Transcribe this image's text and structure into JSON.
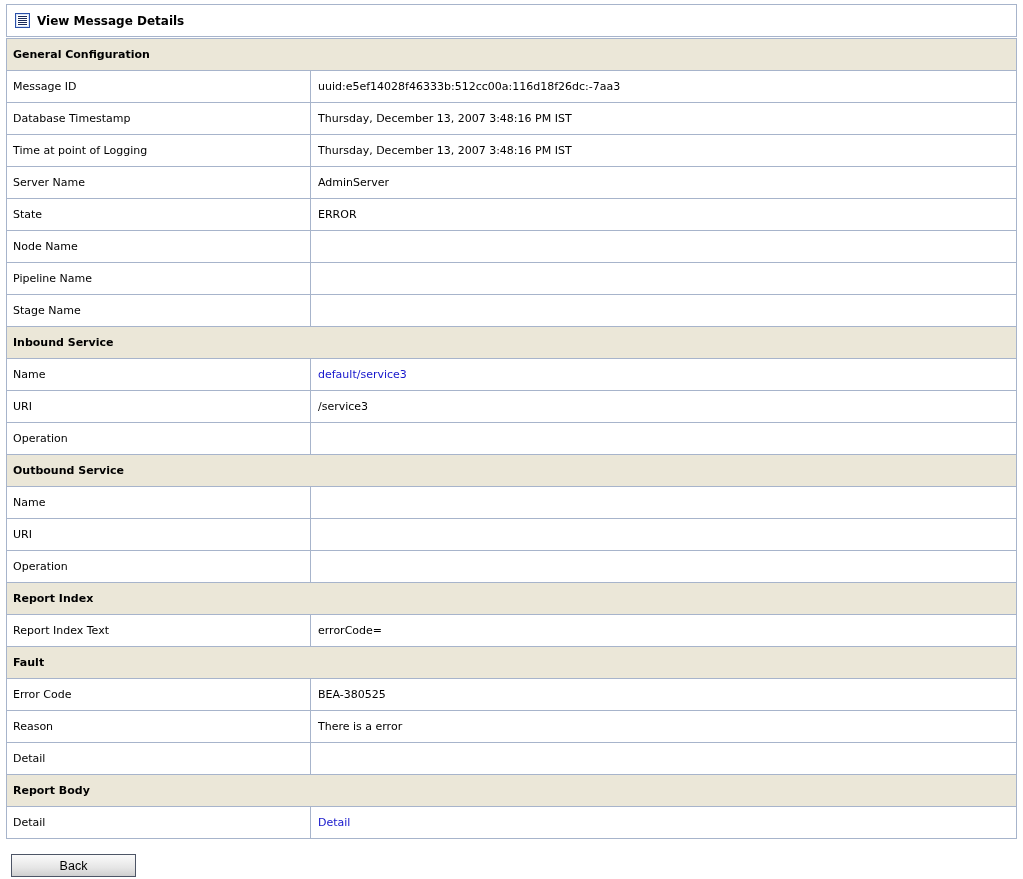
{
  "header": {
    "title": "View Message Details"
  },
  "sections": [
    {
      "title": "General Configuration",
      "rows": [
        {
          "label": "Message ID",
          "value": "uuid:e5ef14028f46333b:512cc00a:116d18f26dc:-7aa3",
          "kind": "text"
        },
        {
          "label": "Database Timestamp",
          "value": "Thursday, December 13, 2007 3:48:16 PM IST",
          "kind": "text"
        },
        {
          "label": "Time at point of Logging",
          "value": "Thursday, December 13, 2007 3:48:16 PM IST",
          "kind": "text"
        },
        {
          "label": "Server Name",
          "value": "AdminServer",
          "kind": "text"
        },
        {
          "label": "State",
          "value": "ERROR",
          "kind": "text"
        },
        {
          "label": "Node Name"
        },
        {
          "label": "Pipeline Name"
        },
        {
          "label": "Stage Name"
        }
      ]
    },
    {
      "title": "Inbound Service",
      "rows": [
        {
          "label": "Name",
          "value": "default/service3",
          "kind": "link"
        },
        {
          "label": "URI",
          "value": "/service3",
          "kind": "text"
        },
        {
          "label": "Operation"
        }
      ]
    },
    {
      "title": "Outbound Service",
      "rows": [
        {
          "label": "Name"
        },
        {
          "label": "URI"
        },
        {
          "label": "Operation"
        }
      ]
    },
    {
      "title": "Report Index",
      "rows": [
        {
          "label": "Report Index Text",
          "value": "errorCode=",
          "kind": "text"
        }
      ]
    },
    {
      "title": "Fault",
      "rows": [
        {
          "label": "Error Code",
          "value": "BEA-380525",
          "kind": "text"
        },
        {
          "label": "Reason",
          "value": "There is a error",
          "kind": "text"
        },
        {
          "label": "Detail"
        }
      ]
    },
    {
      "title": "Report Body",
      "rows": [
        {
          "label": "Detail",
          "value": "Detail",
          "kind": "link"
        }
      ]
    }
  ],
  "buttons": [
    "Back"
  ]
}
